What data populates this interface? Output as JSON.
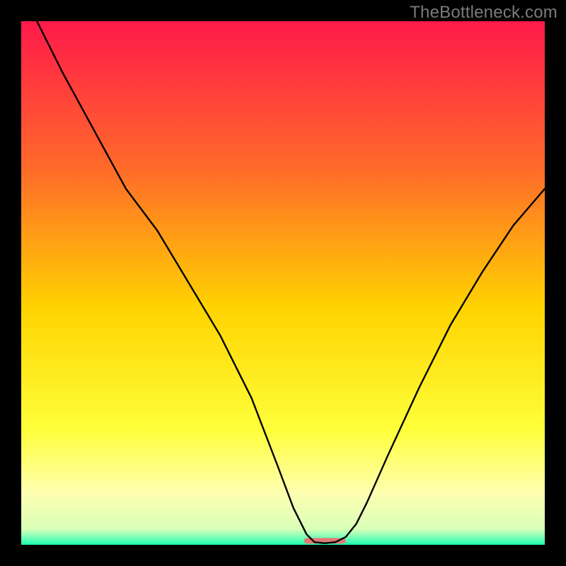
{
  "watermark": "TheBottleneck.com",
  "chart_data": {
    "type": "line",
    "title": "",
    "xlabel": "",
    "ylabel": "",
    "xlim": [
      0,
      100
    ],
    "ylim": [
      0,
      100
    ],
    "background_gradient": {
      "top": "#ff1a4a",
      "mid1": "#ff7a2a",
      "mid2": "#ffd400",
      "lower": "#ffff88",
      "bottom": "#1affa9"
    },
    "series": [
      {
        "name": "bottleneck-curve",
        "color": "#000000",
        "x": [
          3,
          8,
          14,
          20,
          26,
          32,
          38,
          44,
          49,
          52,
          54.5,
          56,
          58,
          60,
          62,
          64,
          66,
          70,
          76,
          82,
          88,
          94,
          100
        ],
        "y": [
          100,
          90,
          79,
          68,
          60,
          50,
          40,
          28,
          15,
          7,
          2,
          0.5,
          0.3,
          0.5,
          1.5,
          4,
          8,
          17,
          30,
          42,
          52,
          61,
          68
        ]
      }
    ],
    "marker": {
      "name": "optimal-marker",
      "color": "#e07a74",
      "x_start": 54,
      "x_end": 62,
      "y": 0.2,
      "height": 1.1
    }
  }
}
